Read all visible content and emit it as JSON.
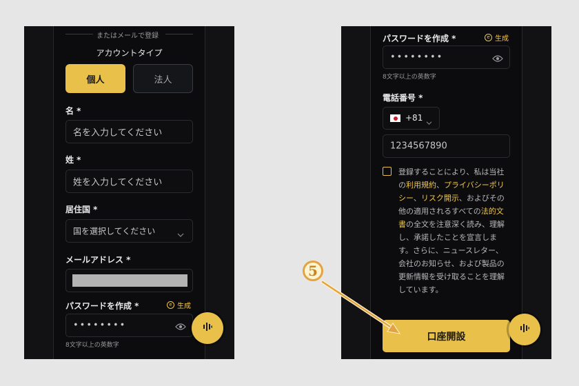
{
  "left": {
    "divider_text": "またはメールで登録",
    "account_type_title": "アカウントタイプ",
    "account_types": [
      "個人",
      "法人"
    ],
    "first_name_label": "名 *",
    "first_name_placeholder": "名を入力してください",
    "last_name_label": "姓 *",
    "last_name_placeholder": "姓を入力してください",
    "country_label": "居住国 *",
    "country_placeholder": "国を選択してください",
    "email_label": "メールアドレス *",
    "password_label": "パスワードを作成 *",
    "generate_label": "生成",
    "password_value": "••••••••",
    "password_hint": "8文字以上の英数字"
  },
  "right": {
    "password_label": "パスワードを作成 *",
    "generate_label": "生成",
    "password_value": "••••••••",
    "password_hint": "8文字以上の英数字",
    "phone_label": "電話番号 *",
    "country_code": "+81",
    "phone_placeholder": "1234567890",
    "terms": {
      "p1": "登録することにより、私は当社の",
      "l1": "利用規約",
      "p2": "、",
      "l2": "プライバシーポリシー",
      "p3": "、",
      "l3": "リスク開示",
      "p4": "、およびその他の適用されるすべての",
      "l4": "法的文書",
      "p5": "の全文を注意深く読み、理解し、承諾したことを宣言します。さらに、ニュースレター、会社のお知らせ、および製品の更新情報を受け取ることを理解しています。"
    },
    "submit_label": "口座開設"
  },
  "annotation": {
    "step_number": "5"
  },
  "colors": {
    "accent": "#e8c04a",
    "background": "#0c0c0e",
    "arrow": "#e3a244"
  }
}
